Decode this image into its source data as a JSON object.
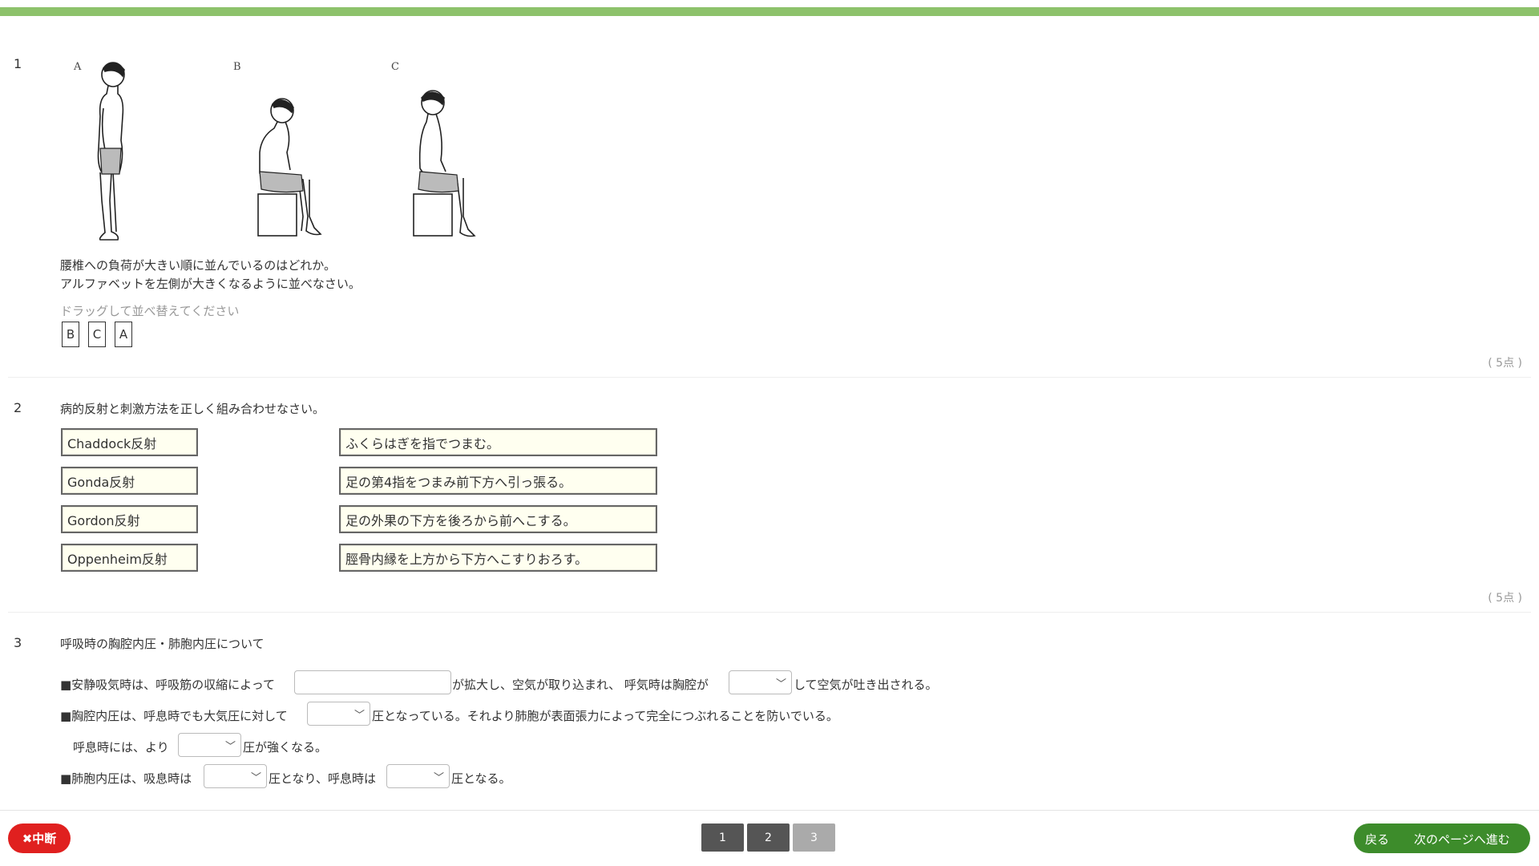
{
  "colors": {
    "accent_bar": "#8dc26b",
    "abort": "#e0201f",
    "nav_green": "#3d8c2b",
    "page_dark": "#555555",
    "page_light": "#aaaaaa",
    "match_bg": "#fffff0"
  },
  "q1": {
    "number": "1",
    "figure_labels": [
      "A",
      "B",
      "C"
    ],
    "question_line1": "腰椎への負荷が大きい順に並んでいるのはどれか。",
    "question_line2": "アルファベットを左側が大きくなるように並べなさい。",
    "hint": "ドラッグして並べ替えてください",
    "order": [
      "B",
      "C",
      "A"
    ],
    "points": "( 5点 )"
  },
  "q2": {
    "number": "2",
    "question": "病的反射と刺激方法を正しく組み合わせなさい。",
    "left": [
      "Chaddock反射",
      "Gonda反射",
      "Gordon反射",
      "Oppenheim反射"
    ],
    "right": [
      "ふくらはぎを指でつまむ。",
      "足の第4指をつまみ前下方へ引っ張る。",
      "足の外果の下方を後ろから前へこする。",
      "脛骨内縁を上方から下方へこすりおろす。"
    ],
    "points": "( 5点 )"
  },
  "q3": {
    "number": "3",
    "title": "呼吸時の胸腔内圧・肺胞内圧について",
    "l1_a": "■安静吸気時は、呼吸筋の収縮によって",
    "l1_b": "が拡大し、空気が取り込まれ、 呼気時は胸腔が",
    "l1_c": "して空気が吐き出される。",
    "l2_a": "■胸腔内圧は、呼息時でも大気圧に対して",
    "l2_b": "圧となっている。それより肺胞が表面張力によって完全につぶれることを防いでいる。",
    "l3_a": "呼息時には、より",
    "l3_b": "圧が強くなる。",
    "l4_a": "■肺胞内圧は、吸息時は",
    "l4_b": "圧となり、呼息時は",
    "l4_c": "圧となる。"
  },
  "footer": {
    "abort": "✖中断",
    "pages": [
      "1",
      "2",
      "3"
    ],
    "current_page": 3,
    "back": "戻る",
    "next": "次のページへ進む"
  }
}
